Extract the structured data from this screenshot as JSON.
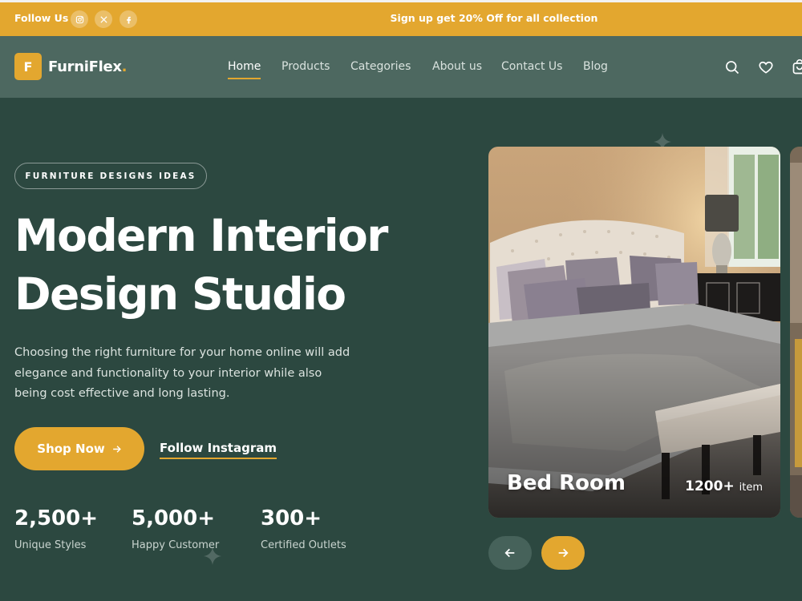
{
  "topbar": {
    "follow_label": "Follow Us",
    "social_icons": [
      "instagram-icon",
      "x-icon",
      "facebook-icon"
    ],
    "promo_text": "Sign up get 20% Off for all collection",
    "background": "#e3a72f"
  },
  "header": {
    "logo_letter": "F",
    "logo_text": "FurniFlex",
    "logo_dot": ".",
    "nav": [
      {
        "label": "Home",
        "active": true
      },
      {
        "label": "Products",
        "active": false
      },
      {
        "label": "Categories",
        "active": false
      },
      {
        "label": "About us",
        "active": false
      },
      {
        "label": "Contact Us",
        "active": false
      },
      {
        "label": "Blog",
        "active": false
      }
    ],
    "icons": [
      "search-icon",
      "heart-icon",
      "cart-icon"
    ],
    "background": "#4d6860"
  },
  "hero": {
    "tag": "FURNITURE DESIGNS IDEAS",
    "title_line1": "Modern Interior",
    "title_line2": "Design Studio",
    "description": "Choosing the right furniture for your home online will add elegance and functionality to your interior while also being cost effective and long lasting.",
    "shop_button": "Shop Now",
    "instagram_link": "Follow Instagram",
    "stats": [
      {
        "value": "2,500+",
        "label": "Unique Styles"
      },
      {
        "value": "5,000+",
        "label": "Happy Customer"
      },
      {
        "value": "300+",
        "label": "Certified Outlets"
      }
    ],
    "background": "#2c4840"
  },
  "carousel": {
    "card_title": "Bed Room",
    "card_count": "1200+",
    "card_count_unit": "item",
    "prev_icon": "arrow-left-icon",
    "next_icon": "arrow-right-icon",
    "accent": "#e3a72f"
  }
}
